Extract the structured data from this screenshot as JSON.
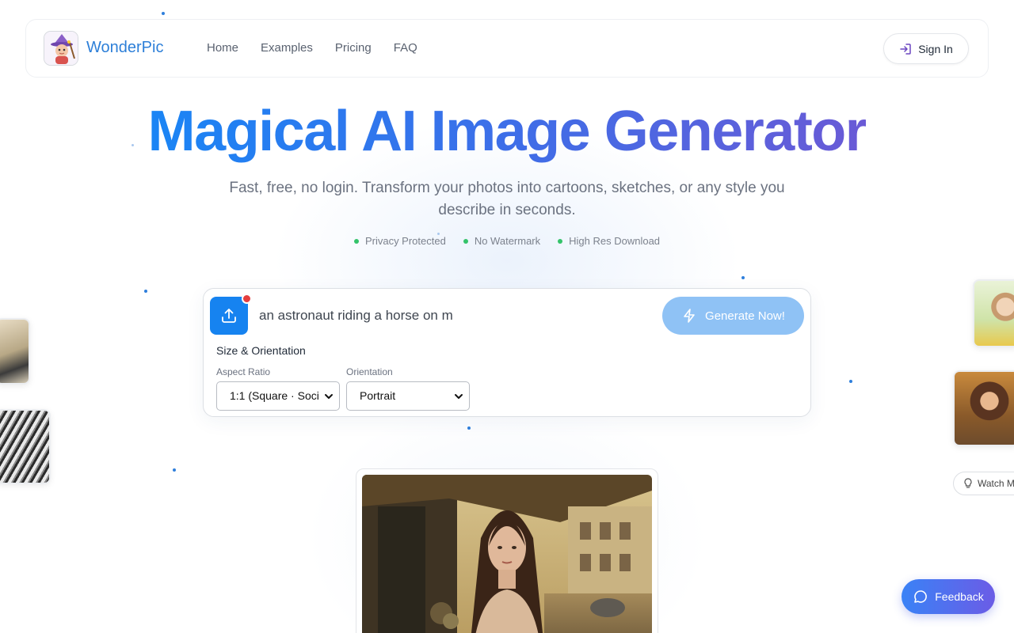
{
  "brand": {
    "name": "WonderPic"
  },
  "nav": {
    "links": [
      "Home",
      "Examples",
      "Pricing",
      "FAQ"
    ],
    "signin_label": "Sign In"
  },
  "hero": {
    "title": "Magical AI Image Generator",
    "subtitle": "Fast, free, no login. Transform your photos into cartoons, sketches, or any style you describe in seconds.",
    "features": [
      "Privacy Protected",
      "No Watermark",
      "High Res Download"
    ]
  },
  "generator": {
    "prompt_value": "an astronaut riding a horse on m",
    "generate_label": "Generate Now!",
    "size_heading": "Size & Orientation",
    "aspect_label": "Aspect Ratio",
    "aspect_value": "1:1 (Square · Soci",
    "orientation_label": "Orientation",
    "orientation_value": "Portrait"
  },
  "side": {
    "watch_label": "Watch M"
  },
  "feedback": {
    "label": "Feedback"
  },
  "colors": {
    "accent": "#1683f0",
    "brand_text": "#2d7fd8",
    "generate_disabled": "#8fc2f5",
    "feature_dot": "#34c36a",
    "notification_dot": "#e53e3e"
  },
  "icons": {
    "signin": "sign-in-icon",
    "upload": "upload-icon",
    "generate": "lightning-icon",
    "select": "chevron-down-icon",
    "watch": "lightbulb-icon",
    "feedback": "chat-bubble-icon"
  }
}
